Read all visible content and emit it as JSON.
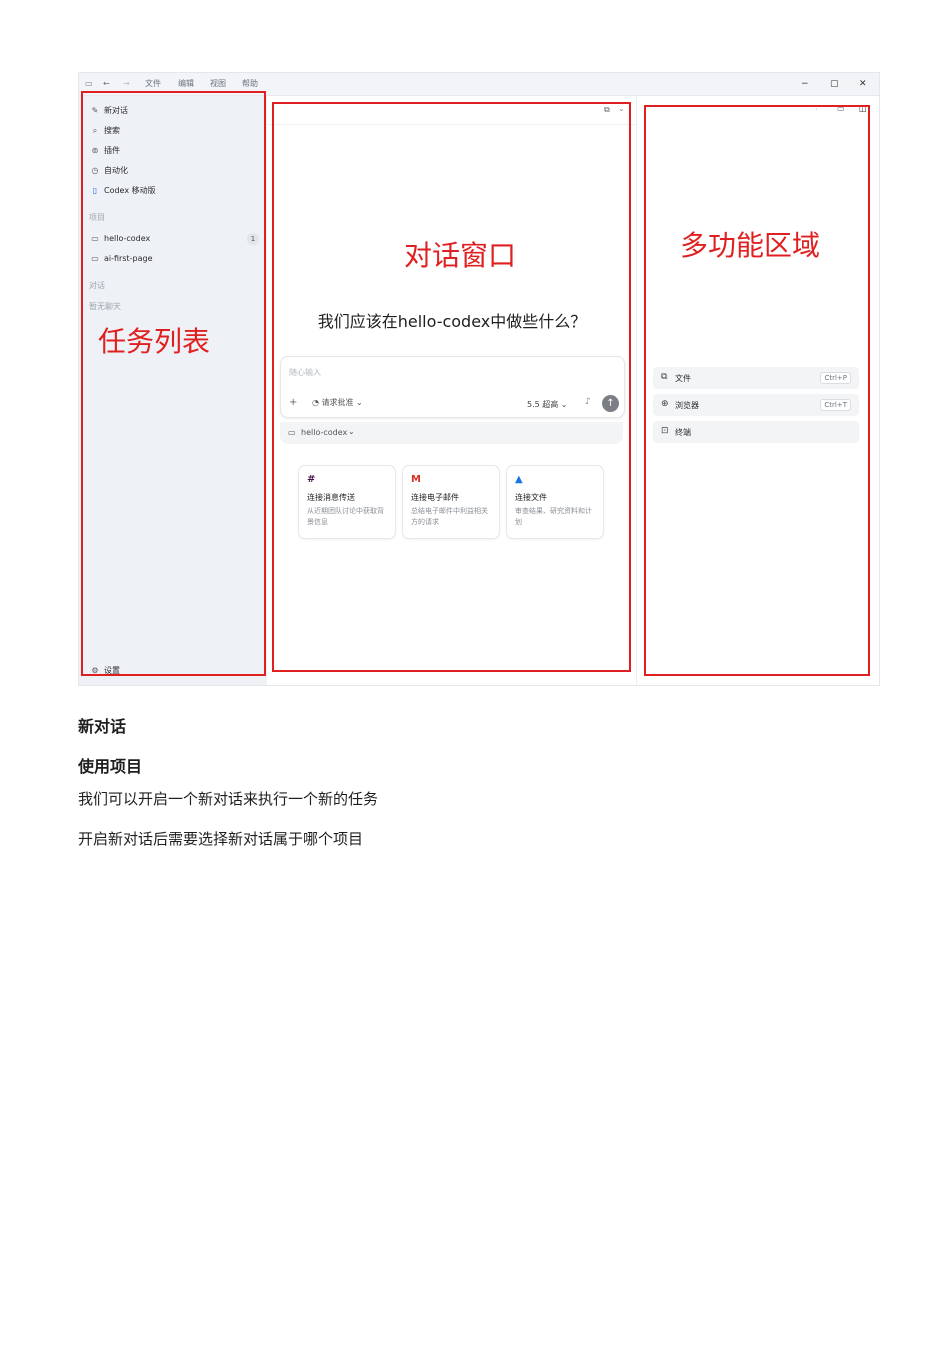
{
  "titlebar": {
    "menu": [
      "文件",
      "编辑",
      "视图",
      "帮助"
    ],
    "minimize": "−",
    "maximize": "▢",
    "close": "✕"
  },
  "sidebar": {
    "items": [
      {
        "label": "新对话",
        "icon": "compose-icon"
      },
      {
        "label": "搜索",
        "icon": "search-icon"
      },
      {
        "label": "插件",
        "icon": "plugin-icon"
      },
      {
        "label": "自动化",
        "icon": "clock-icon"
      },
      {
        "label": "Codex 移动版",
        "icon": "mobile-icon"
      }
    ],
    "projects_label": "项目",
    "projects": [
      {
        "label": "hello-codex",
        "badge": "1"
      },
      {
        "label": "ai-first-page"
      }
    ],
    "chats_label": "对话",
    "no_chats": "暂无聊天",
    "settings": "设置"
  },
  "main": {
    "question": "我们应该在hello-codex中做些什么？",
    "composer": {
      "placeholder": "随心输入",
      "approval": "请求批准",
      "model": "5.5 超高"
    },
    "project_chip": "hello-codex",
    "cards": [
      {
        "title": "连接消息传送",
        "desc": "从近期团队讨论中获取背景信息",
        "icon": "slack-icon"
      },
      {
        "title": "连接电子邮件",
        "desc": "总结电子邮件中利益相关方的请求",
        "icon": "gmail-icon"
      },
      {
        "title": "连接文件",
        "desc": "审查结果、研究资料和计划",
        "icon": "drive-icon"
      }
    ]
  },
  "right_panel": {
    "tools": [
      {
        "label": "文件",
        "shortcut": "Ctrl+P",
        "icon": "files-icon"
      },
      {
        "label": "浏览器",
        "shortcut": "Ctrl+T",
        "icon": "globe-icon"
      },
      {
        "label": "终端",
        "shortcut": "",
        "icon": "terminal-icon"
      }
    ]
  },
  "annotations": {
    "task_list": "任务列表",
    "chat_window": "对话窗口",
    "multi_area": "多功能区域",
    "color": "#e02020"
  },
  "document": {
    "heading1": "新对话",
    "heading2": "使用项目",
    "para1": "我们可以开启一个新对话来执行一个新的任务",
    "para2": "开启新对话后需要选择新对话属于哪个项目"
  }
}
